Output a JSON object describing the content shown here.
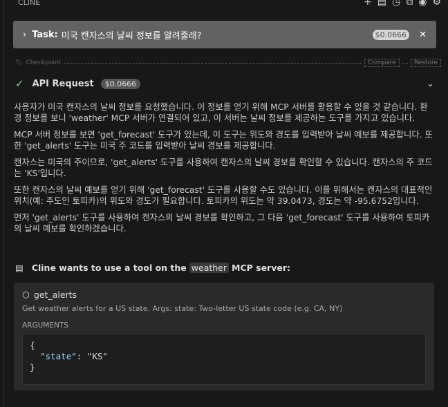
{
  "header": {
    "title": "CLINE",
    "icons": [
      "plus-icon",
      "server-icon",
      "history-icon",
      "popout-icon",
      "account-icon",
      "gear-icon"
    ]
  },
  "task": {
    "label": "Task:",
    "text": "미국 캔자스의 날씨 정보를 알려줄래?",
    "cost": "$0.0666"
  },
  "checkpoint": {
    "label": "Checkpoint",
    "compare": "Compare",
    "restore": "Restore"
  },
  "api": {
    "label": "API Request",
    "cost": "$0.0666"
  },
  "paragraphs": [
    "사용자가 미국 캔자스의 날씨 정보를 요청했습니다. 이 정보를 얻기 위해 MCP 서버를 활용할 수 있을 것 같습니다. 환경 정보를 보니 'weather' MCP 서버가 연결되어 있고, 이 서버는 날씨 정보를 제공하는 도구를 가지고 있습니다.",
    "MCP 서버 정보를 보면 'get_forecast' 도구가 있는데, 이 도구는 위도와 경도를 입력받아 날씨 예보를 제공합니다. 또한 'get_alerts' 도구는 미국 주 코드를 입력받아 날씨 경보를 제공합니다.",
    "캔자스는 미국의 주이므로, 'get_alerts' 도구를 사용하여 캔자스의 날씨 경보를 확인할 수 있습니다. 캔자스의 주 코드는 'KS'입니다.",
    "또한 캔자스의 날씨 예보를 얻기 위해 'get_forecast' 도구를 사용할 수도 있습니다. 이를 위해서는 캔자스의 대표적인 위치(예: 주도인 토피카)의 위도와 경도가 필요합니다. 토피카의 위도는 약 39.0473, 경도는 약 -95.6752입니다.",
    "먼저 'get_alerts' 도구를 사용하여 캔자스의 날씨 경보를 확인하고, 그 다음 'get_forecast' 도구를 사용하여 토피카의 날씨 예보를 확인하겠습니다."
  ],
  "mcp": {
    "prefix": "Cline wants to use a tool on the",
    "server": "weather",
    "suffix": "MCP server:"
  },
  "tool": {
    "name": "get_alerts",
    "description": "Get weather alerts for a US state. Args: state: Two-letter US state code (e.g. CA, NY)",
    "args_label": "ARGUMENTS",
    "open": "{",
    "key": "\"state\"",
    "sep": ": ",
    "value": "\"KS\"",
    "close": "}"
  }
}
